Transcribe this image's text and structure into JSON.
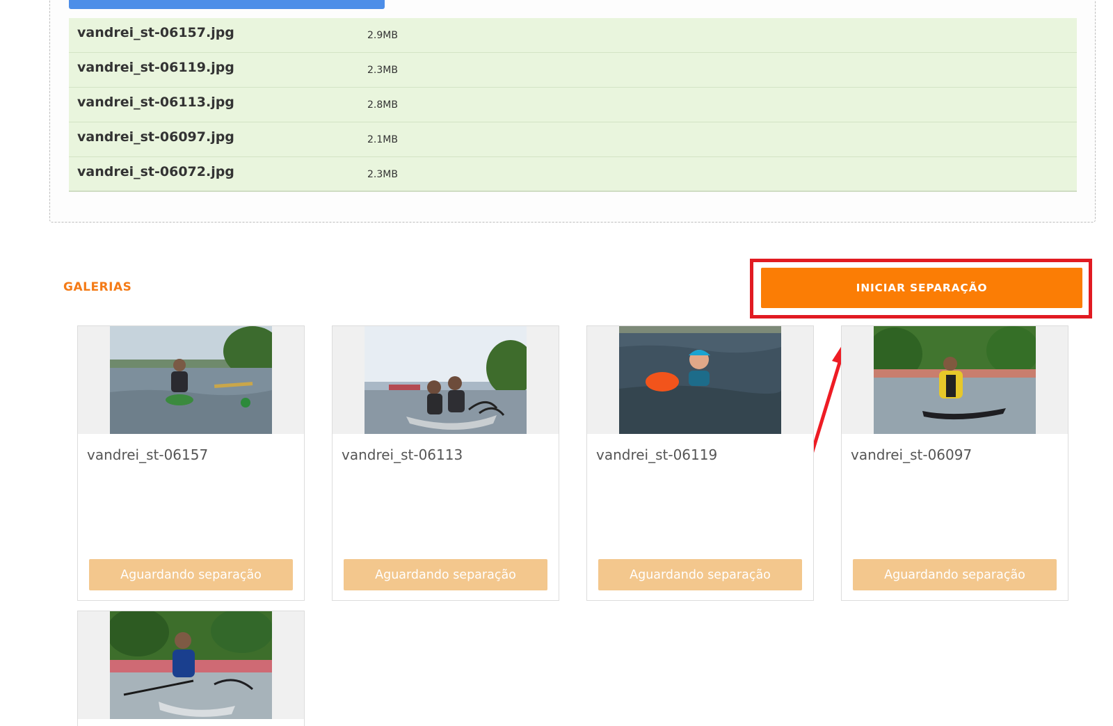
{
  "upload": {
    "files": [
      {
        "name": "vandrei_st-06157.jpg",
        "size": "2.9MB"
      },
      {
        "name": "vandrei_st-06119.jpg",
        "size": "2.3MB"
      },
      {
        "name": "vandrei_st-06113.jpg",
        "size": "2.8MB"
      },
      {
        "name": "vandrei_st-06097.jpg",
        "size": "2.1MB"
      },
      {
        "name": "vandrei_st-06072.jpg",
        "size": "2.3MB"
      }
    ]
  },
  "gallery": {
    "title": "GALERIAS",
    "start_button": "INICIAR SEPARAÇÃO",
    "cards": [
      {
        "name": "vandrei_st-06157",
        "status": "Aguardando separação"
      },
      {
        "name": "vandrei_st-06113",
        "status": "Aguardando separação"
      },
      {
        "name": "vandrei_st-06119",
        "status": "Aguardando separação"
      },
      {
        "name": "vandrei_st-06097",
        "status": "Aguardando separação"
      },
      {
        "name": "",
        "status": ""
      }
    ]
  },
  "colors": {
    "accent_orange": "#fb7d05",
    "status_button": "#f3c78d",
    "file_row_bg": "#e9f5dd",
    "highlight_red": "#e11b22",
    "progress_blue": "#4d8ee8"
  },
  "icons": [
    "annotation-arrow"
  ]
}
